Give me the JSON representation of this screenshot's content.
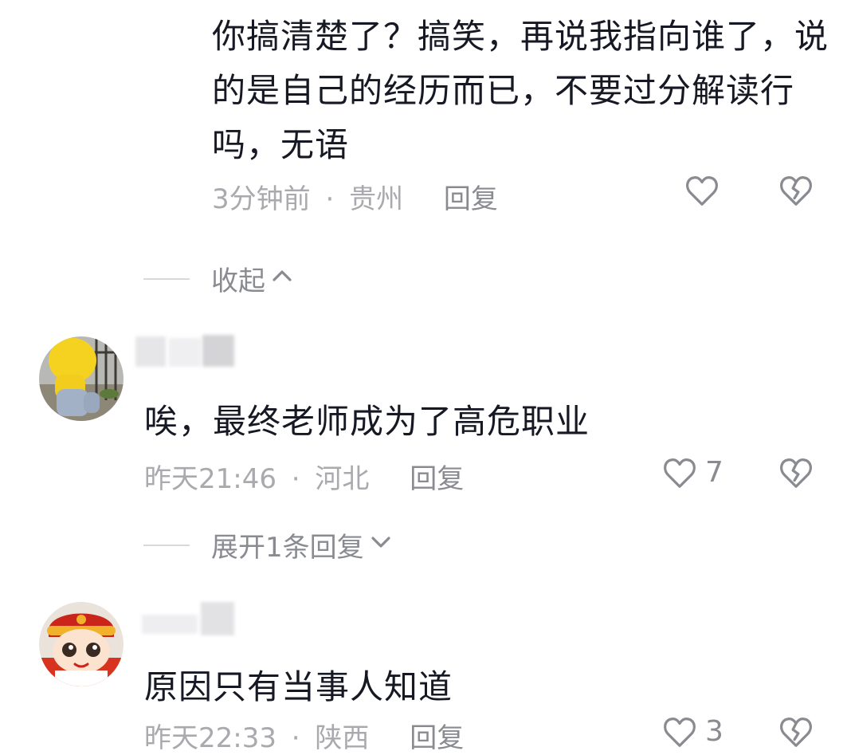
{
  "top_reply": {
    "text": "你搞清楚了？搞笑，再说我指向谁了，说的是自己的经历而已，不要过分解读行吗，无语",
    "time": "3分钟前",
    "location": "贵州",
    "reply_label": "回复"
  },
  "collapse_label": "收起",
  "comments": [
    {
      "text": "唉，最终老师成为了高危职业",
      "time": "昨天21:46",
      "location": "河北",
      "reply_label": "回复",
      "likes": "7",
      "expand_label": "展开1条回复"
    },
    {
      "text": "原因只有当事人知道",
      "time": "昨天22:33",
      "location": "陕西",
      "reply_label": "回复",
      "likes": "3"
    }
  ],
  "separator": "·",
  "icons": {
    "like": "heart-outline-icon",
    "dislike": "broken-heart-icon",
    "collapse": "chevron-up-icon",
    "expand": "chevron-down-icon"
  },
  "colors": {
    "text": "#161823",
    "meta": "#a9a9ae",
    "action": "#8a8b91",
    "divider": "#d9d9dc"
  }
}
